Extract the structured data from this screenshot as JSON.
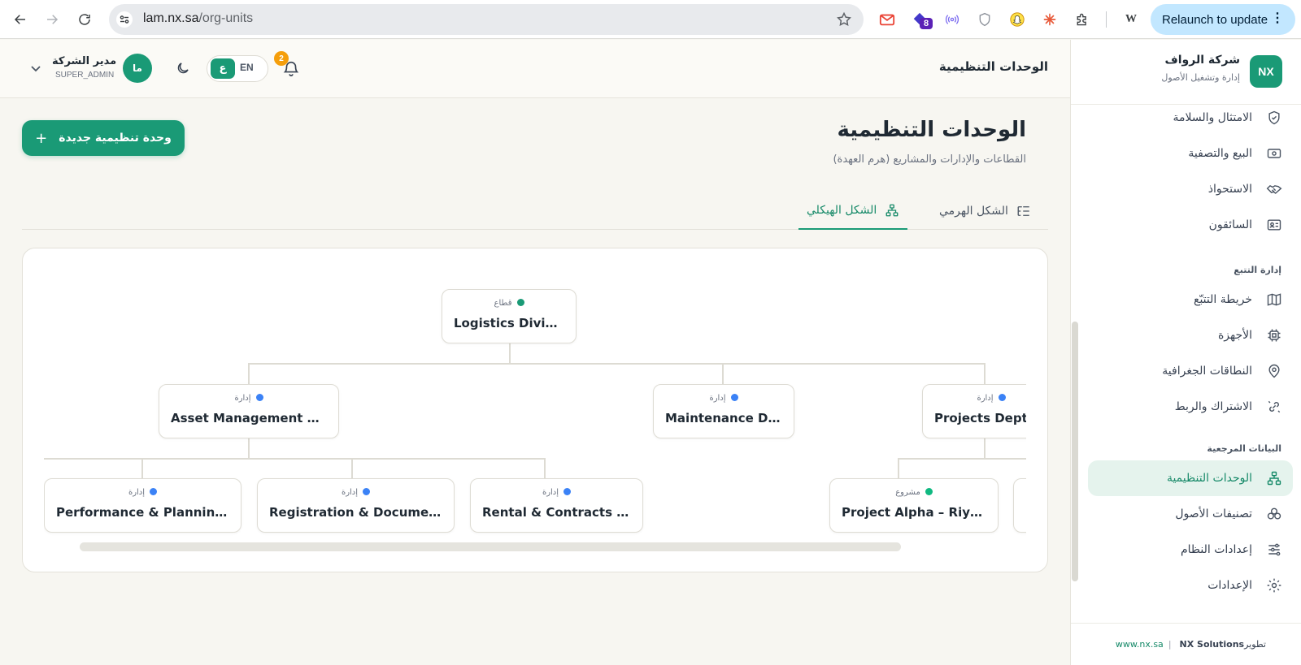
{
  "browser": {
    "url_host": "lam.nx.sa",
    "url_path": "/org-units",
    "ext_badge": "8",
    "relaunch_label": "Relaunch to update"
  },
  "sidebar": {
    "brand_logo": "NX",
    "brand_name": "شركة الرواف",
    "brand_sub": "إدارة وتشغيل الأصول",
    "items_top": [
      {
        "label": "الامتثال والسلامة",
        "icon": "shield-check-icon"
      },
      {
        "label": "البيع والتصفية",
        "icon": "banknote-icon"
      },
      {
        "label": "الاستحواذ",
        "icon": "handshake-icon"
      },
      {
        "label": "السائقون",
        "icon": "id-card-icon"
      }
    ],
    "section_tracking": "إدارة التتبع",
    "items_tracking": [
      {
        "label": "خريطة التتبّع",
        "icon": "map-icon"
      },
      {
        "label": "الأجهزة",
        "icon": "cpu-icon"
      },
      {
        "label": "النطاقات الجغرافية",
        "icon": "map-pin-icon"
      },
      {
        "label": "الاشتراك والربط",
        "icon": "link-icon"
      }
    ],
    "section_reference": "البيانات المرجعية",
    "items_reference": [
      {
        "label": "الوحدات التنظيمية",
        "icon": "network-icon",
        "active": true
      },
      {
        "label": "تصنيفات الأصول",
        "icon": "shapes-icon"
      },
      {
        "label": "إعدادات النظام",
        "icon": "sliders-icon"
      },
      {
        "label": "الإعدادات",
        "icon": "gear-icon"
      }
    ],
    "footer_link": "www.nx.sa",
    "footer_brand": "NX Solutions",
    "footer_text": "تطوير"
  },
  "header": {
    "title": "الوحدات التنظيمية",
    "user_name": "مدير الشركة",
    "user_role": "SUPER_ADMIN",
    "avatar_initials": "ما",
    "lang_ar": "ع",
    "lang_en": "EN",
    "notification_count": "2"
  },
  "page": {
    "title": "الوحدات التنظيمية",
    "subtitle": "القطاعات والإدارات والمشاريع (هرم العهدة)",
    "new_button": "وحدة تنظيمية جديدة",
    "tabs": [
      {
        "label": "الشكل الهيكلي",
        "icon": "org-chart-icon",
        "active": true
      },
      {
        "label": "الشكل الهرمي",
        "icon": "list-tree-icon",
        "active": false
      }
    ]
  },
  "org_chart": {
    "root": {
      "type": "قطاع",
      "name": "Logistics Division",
      "dot": "#1a9a76"
    },
    "level2": [
      {
        "type": "إدارة",
        "name": "Asset Management Dept",
        "dot": "#3b82f6"
      },
      {
        "type": "إدارة",
        "name": "Maintenance Dept",
        "dot": "#3b82f6"
      },
      {
        "type": "إدارة",
        "name": "Projects Dept",
        "dot": "#3b82f6"
      }
    ],
    "level3": [
      {
        "type": "إدارة",
        "name": "Performance & Planning Unit",
        "dot": "#3b82f6"
      },
      {
        "type": "إدارة",
        "name": "Registration & Documentation Unit",
        "dot": "#3b82f6"
      },
      {
        "type": "إدارة",
        "name": "Rental & Contracts Unit",
        "dot": "#3b82f6"
      },
      {
        "type": "مشروع",
        "name": "Project Alpha – Riyadh",
        "dot": "#10b981"
      }
    ]
  }
}
